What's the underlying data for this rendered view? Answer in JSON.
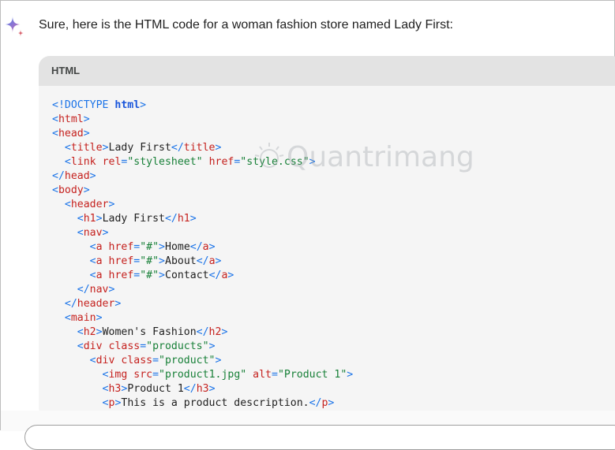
{
  "intro_text": "Sure, here is the HTML code for a woman fashion store named Lady First:",
  "code_block": {
    "language_label": "HTML",
    "lines": [
      [
        "<!DOCTYPE ",
        "html",
        ">"
      ],
      [
        "<html>"
      ],
      [
        "<head>"
      ],
      [
        "  <title>Lady First</title>"
      ],
      [
        "  <link rel=\"stylesheet\" href=\"style.css\">"
      ],
      [
        "</head>"
      ],
      [
        "<body>"
      ],
      [
        "  <header>"
      ],
      [
        "    <h1>Lady First</h1>"
      ],
      [
        "    <nav>"
      ],
      [
        "      <a href=\"#\">Home</a>"
      ],
      [
        "      <a href=\"#\">About</a>"
      ],
      [
        "      <a href=\"#\">Contact</a>"
      ],
      [
        "    </nav>"
      ],
      [
        "  </header>"
      ],
      [
        "  <main>"
      ],
      [
        "    <h2>Women's Fashion</h2>"
      ],
      [
        "    <div class=\"products\">"
      ],
      [
        "      <div class=\"product\">"
      ],
      [
        "        <img src=\"product1.jpg\" alt=\"Product 1\">"
      ],
      [
        "        <h3>Product 1</h3>"
      ],
      [
        "        <p>This is a product description.</p>"
      ]
    ]
  },
  "watermark": "Quantrimang",
  "colors": {
    "tag": "#c5221f",
    "string": "#188038",
    "punct": "#1a73e8",
    "keyword": "#1a56db"
  }
}
